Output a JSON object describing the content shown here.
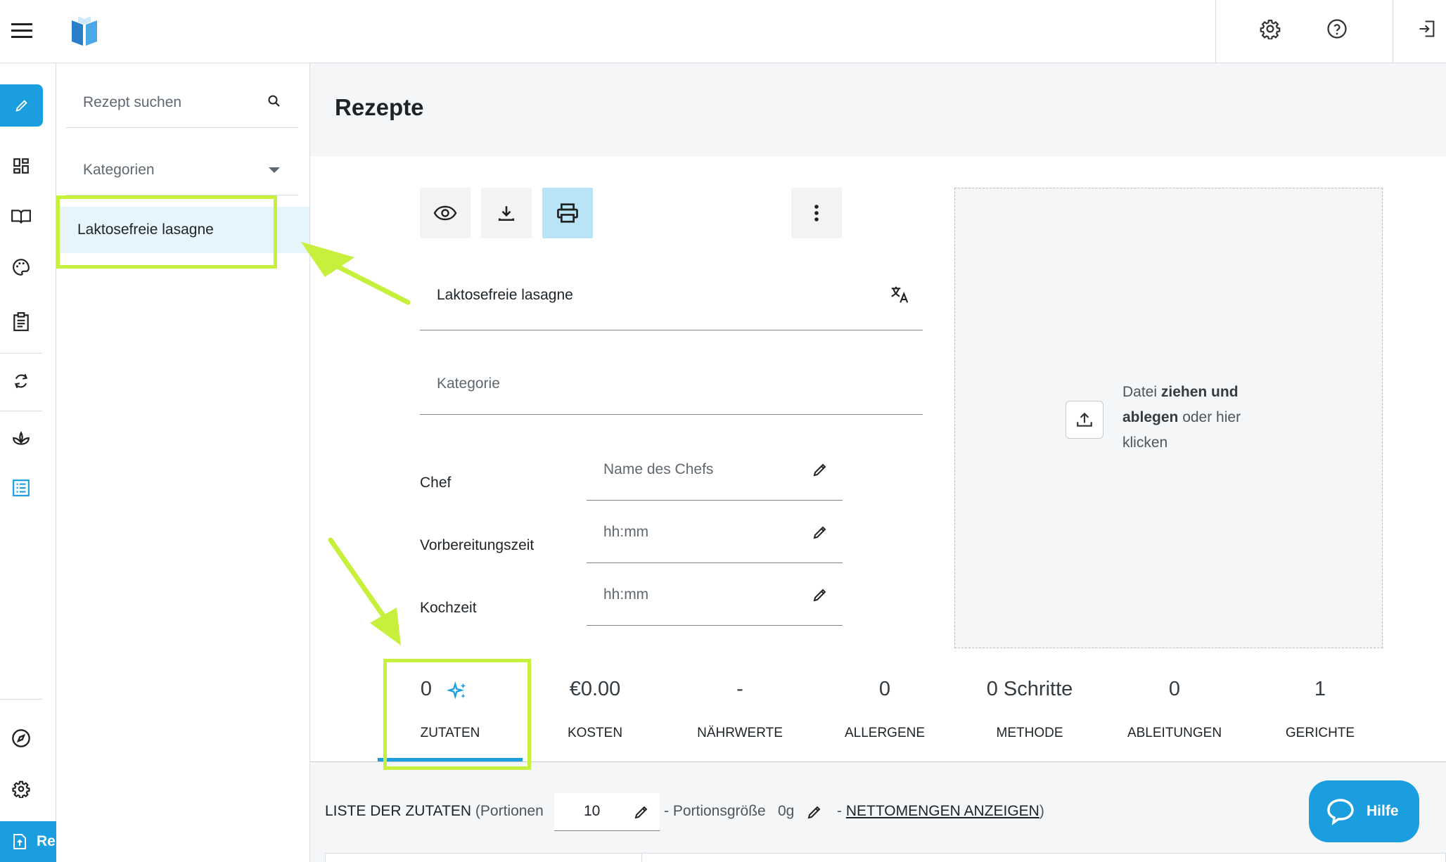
{
  "app": {
    "sidebar_bottom_label": "Re"
  },
  "sidebar": {
    "search_placeholder": "Rezept suchen",
    "categories_label": "Kategorien",
    "selected_recipe": "Laktosefreie lasagne"
  },
  "main": {
    "title": "Rezepte",
    "recipe_name": "Laktosefreie lasagne",
    "category_placeholder": "Kategorie",
    "chef_label": "Chef",
    "chef_placeholder": "Name des Chefs",
    "prep_label": "Vorbereitungszeit",
    "prep_placeholder": "hh:mm",
    "cook_label": "Kochzeit",
    "cook_placeholder": "hh:mm"
  },
  "upload": {
    "text_1": "Datei ",
    "text_bold": "ziehen und ablegen",
    "text_2": " oder hier klicken"
  },
  "tabs": [
    {
      "value": "0",
      "label": "ZUTATEN"
    },
    {
      "value": "€0.00",
      "label": "KOSTEN"
    },
    {
      "value": "-",
      "label": "NÄHRWERTE"
    },
    {
      "value": "0",
      "label": "ALLERGENE"
    },
    {
      "value": "0 Schritte",
      "label": "METHODE"
    },
    {
      "value": "0",
      "label": "ABLEITUNGEN"
    },
    {
      "value": "1",
      "label": "GERICHTE"
    }
  ],
  "ingredients": {
    "title": "LISTE DER ZUTATEN",
    "portions_prefix": "(Portionen",
    "portions_value": "10",
    "portion_size_text": "- Portionsgröße",
    "portion_size_value": "0g",
    "net_prefix": "-",
    "net_link": "NETTOMENGEN ANZEIGEN",
    "close_paren": ")"
  },
  "help": {
    "label": "Hilfe"
  },
  "colors": {
    "accent": "#1a9ee0",
    "annotation": "#c6f03b",
    "selected_bg": "#e6f4fb"
  }
}
